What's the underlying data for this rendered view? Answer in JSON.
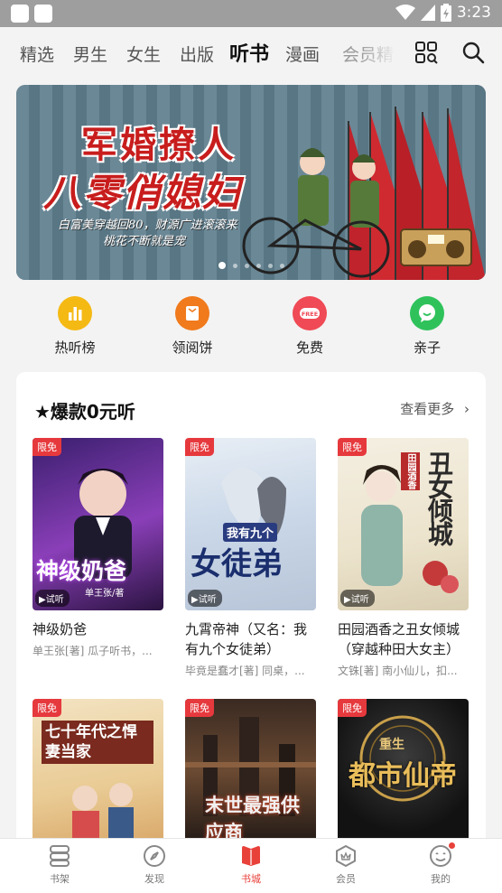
{
  "status_bar": {
    "time": "3:23"
  },
  "top_tabs": [
    {
      "label": "精选"
    },
    {
      "label": "男生"
    },
    {
      "label": "女生"
    },
    {
      "label": "出版"
    },
    {
      "label": "听书",
      "active": true
    },
    {
      "label": "漫画"
    },
    {
      "label": "会员精"
    }
  ],
  "header_icons": [
    "category-grid-icon",
    "search-icon"
  ],
  "banner": {
    "title_line1": "军婚撩人",
    "title_line2": "八零俏媳妇",
    "subtitle_line1": "白富美穿越回80，财源广进滚滚来",
    "subtitle_line2": "桃花不断就是宠",
    "page_count": 6,
    "current_page": 1
  },
  "shortcuts": [
    {
      "label": "热听榜",
      "icon": "chart-icon",
      "color": "#f5b914"
    },
    {
      "label": "领阅饼",
      "icon": "envelope-icon",
      "color": "#f07a1c"
    },
    {
      "label": "免费",
      "icon": "free-icon",
      "color": "#ef4a55"
    },
    {
      "label": "亲子",
      "icon": "chat-bubble-icon",
      "color": "#2fc25b"
    }
  ],
  "section": {
    "title": "★爆款0元听",
    "more_label": "查看更多"
  },
  "books": [
    {
      "badge": "限免",
      "title": "神级奶爸",
      "author": "单王张[著] 瓜子听书，...",
      "trial": "▶试听",
      "cover_text": "神级奶爸",
      "cover_sub": "单王张/著"
    },
    {
      "badge": "限免",
      "title": "九霄帝神（又名：我有九个女徒弟）",
      "author": "毕竟是蠢才[著] 同桌，...",
      "trial": "▶试听",
      "cover_text": "女徒弟",
      "cover_sub": "我有九个"
    },
    {
      "badge": "限免",
      "title": "田园酒香之丑女倾城（穿越种田大女主）",
      "author": "文铢[著] 南小仙儿，扣...",
      "trial": "▶试听",
      "cover_text": "丑女倾城",
      "cover_sub": "田园酒香"
    },
    {
      "badge": "限免",
      "cover_text": "七十年代之悍妻当家",
      "cover_sub": ""
    },
    {
      "badge": "限免",
      "cover_text": "末世最强供应商",
      "cover_sub": ""
    },
    {
      "badge": "限免",
      "cover_text": "都市仙帝",
      "cover_sub": "重生"
    }
  ],
  "bottom_nav": [
    {
      "label": "书架",
      "icon": "bookshelf-icon"
    },
    {
      "label": "发现",
      "icon": "compass-icon"
    },
    {
      "label": "书城",
      "icon": "bookstore-icon",
      "active": true
    },
    {
      "label": "会员",
      "icon": "vip-icon"
    },
    {
      "label": "我的",
      "icon": "profile-icon",
      "dot": true
    }
  ],
  "colors": {
    "accent": "#e8413a",
    "badge": "#e6393d"
  }
}
